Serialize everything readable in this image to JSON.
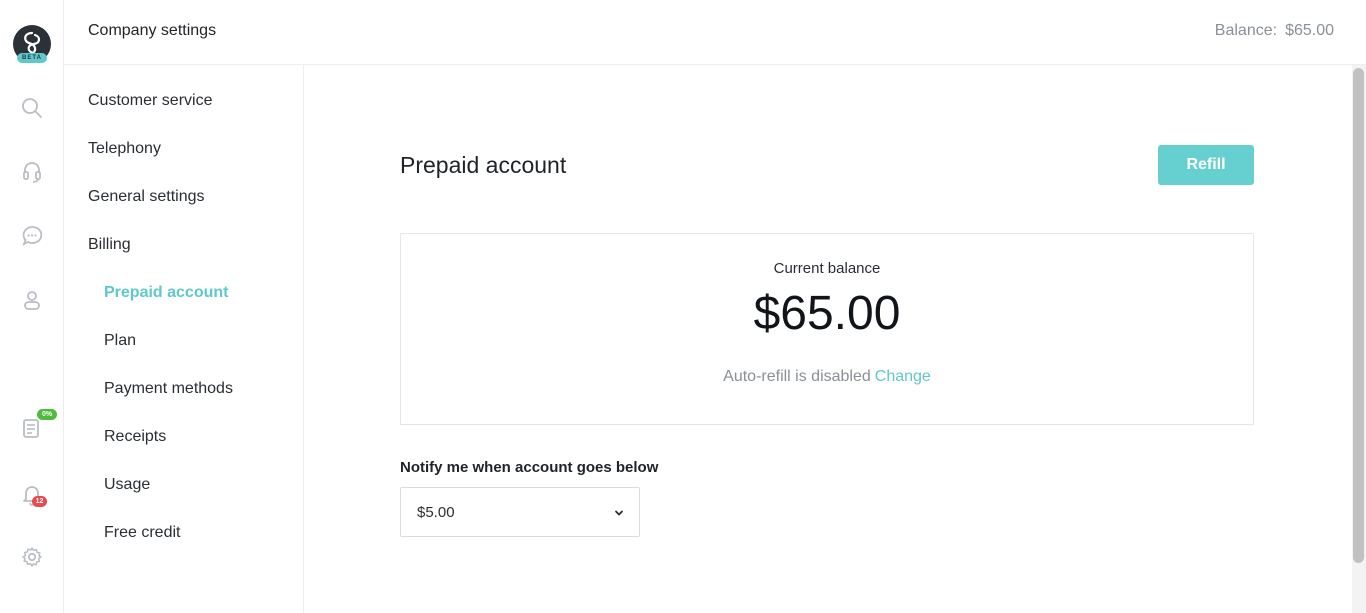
{
  "logo": {
    "badge_text": "BETA"
  },
  "rail": {
    "items": [
      {
        "icon": "search-icon"
      },
      {
        "icon": "headset-icon"
      },
      {
        "icon": "chat-icon"
      },
      {
        "icon": "contacts-icon"
      },
      {
        "icon": "checklist-icon",
        "badge": "0%"
      },
      {
        "icon": "bell-icon",
        "badge": "12"
      },
      {
        "icon": "gear-icon"
      }
    ]
  },
  "topbar": {
    "title": "Company settings",
    "balance_label": "Balance:",
    "balance_value": "$65.00"
  },
  "subnav": {
    "items": [
      {
        "label": "Customer service"
      },
      {
        "label": "Telephony"
      },
      {
        "label": "General settings"
      },
      {
        "label": "Billing"
      },
      {
        "label": "Prepaid account",
        "active": true
      },
      {
        "label": "Plan"
      },
      {
        "label": "Payment methods"
      },
      {
        "label": "Receipts"
      },
      {
        "label": "Usage"
      },
      {
        "label": "Free credit"
      }
    ]
  },
  "main": {
    "title": "Prepaid account",
    "refill_label": "Refill",
    "current_balance_label": "Current balance",
    "current_balance_value": "$65.00",
    "autorefill_text": "Auto-refill is disabled",
    "change_link": "Change",
    "notify_label": "Notify me when account goes below",
    "notify_value": "$5.00"
  },
  "colors": {
    "accent": "#5fc8cb",
    "button": "#66cfd0",
    "badge_green": "#4cbc3a",
    "badge_red": "#e8484f"
  }
}
